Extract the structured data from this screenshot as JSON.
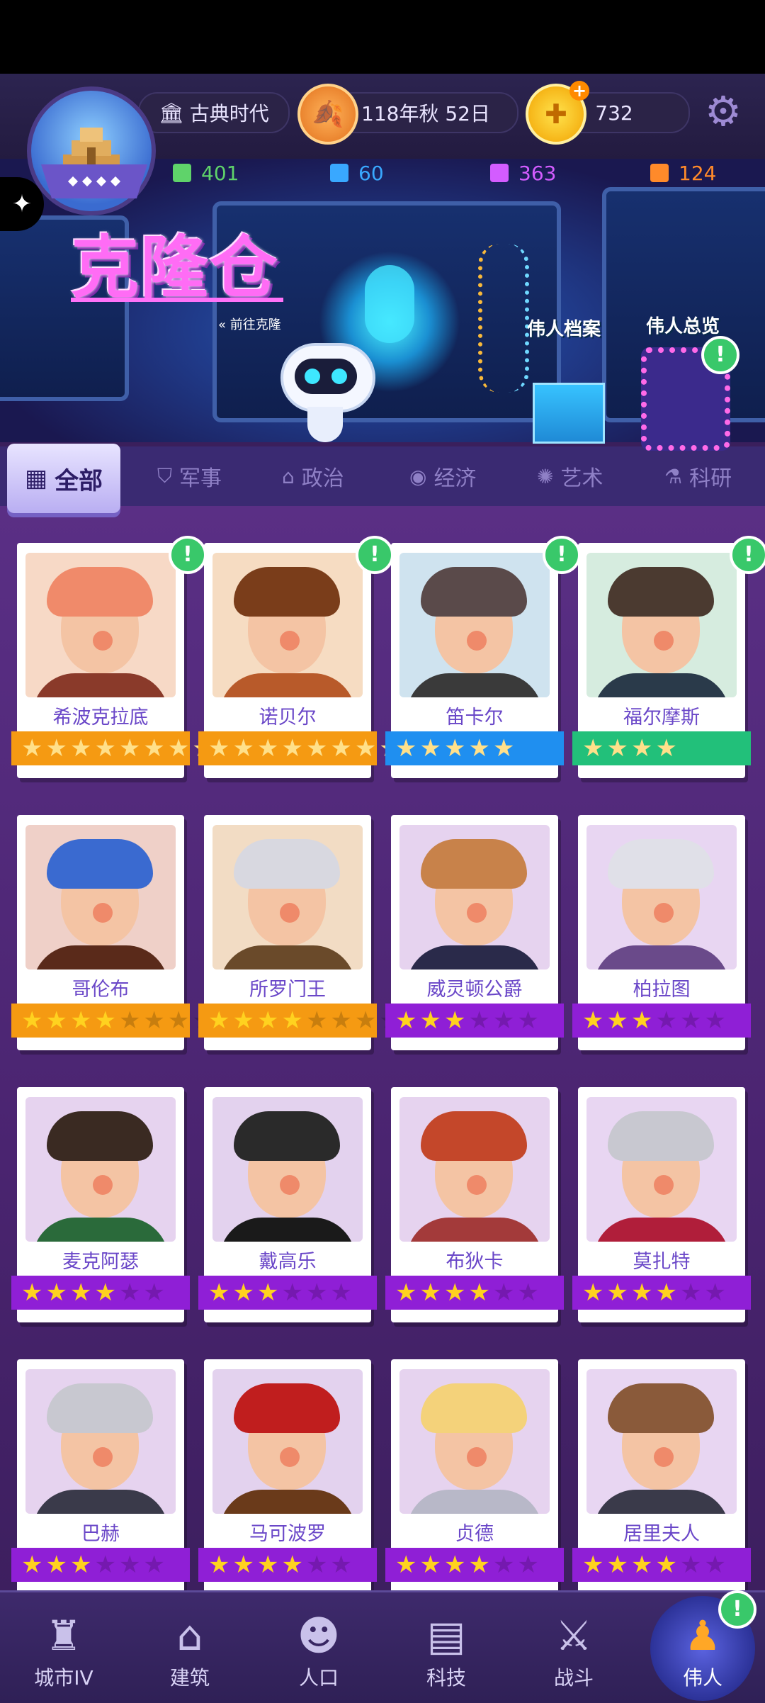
{
  "header": {
    "era": "古典时代",
    "date": "118年秋 52日",
    "coins": "732",
    "coin_plus": "+"
  },
  "resources": [
    {
      "value": "401",
      "color": "#5fd36a"
    },
    {
      "value": "60",
      "color": "#39a8ff"
    },
    {
      "value": "363",
      "color": "#d35cff"
    },
    {
      "value": "124",
      "color": "#ff8a2a"
    }
  ],
  "banner": {
    "title": "克隆仓",
    "go_clone": "前往克隆",
    "archive": "伟人档案",
    "overview": "伟人总览"
  },
  "tabs": [
    {
      "label": "全部",
      "icon": "grid-icon"
    },
    {
      "label": "军事",
      "icon": "shield-icon"
    },
    {
      "label": "政治",
      "icon": "capitol-icon"
    },
    {
      "label": "经济",
      "icon": "coins-icon"
    },
    {
      "label": "艺术",
      "icon": "palette-icon"
    },
    {
      "label": "科研",
      "icon": "flask-icon"
    }
  ],
  "greats": [
    {
      "name": "希波克拉底",
      "stars": 8,
      "max": 8,
      "tier": "orange",
      "alert": true
    },
    {
      "name": "诺贝尔",
      "stars": 8,
      "max": 8,
      "tier": "orange",
      "alert": true
    },
    {
      "name": "笛卡尔",
      "stars": 5,
      "max": 5,
      "tier": "blue",
      "alert": true
    },
    {
      "name": "福尔摩斯",
      "stars": 4,
      "max": 4,
      "tier": "green",
      "alert": true
    },
    {
      "name": "哥伦布",
      "stars": 4,
      "max": 8,
      "tier": "orange",
      "alert": false
    },
    {
      "name": "所罗门王",
      "stars": 4,
      "max": 8,
      "tier": "orange",
      "alert": false
    },
    {
      "name": "威灵顿公爵",
      "stars": 3,
      "max": 6,
      "tier": "purple",
      "alert": false
    },
    {
      "name": "柏拉图",
      "stars": 3,
      "max": 6,
      "tier": "purple",
      "alert": false
    },
    {
      "name": "麦克阿瑟",
      "stars": 4,
      "max": 6,
      "tier": "purple",
      "alert": false
    },
    {
      "name": "戴高乐",
      "stars": 3,
      "max": 6,
      "tier": "purple",
      "alert": false
    },
    {
      "name": "布狄卡",
      "stars": 4,
      "max": 6,
      "tier": "purple",
      "alert": false
    },
    {
      "name": "莫扎特",
      "stars": 4,
      "max": 6,
      "tier": "purple",
      "alert": false
    },
    {
      "name": "巴赫",
      "stars": 3,
      "max": 6,
      "tier": "purple",
      "alert": false
    },
    {
      "name": "马可波罗",
      "stars": 4,
      "max": 6,
      "tier": "purple",
      "alert": false
    },
    {
      "name": "贞德",
      "stars": 4,
      "max": 6,
      "tier": "purple",
      "alert": false
    },
    {
      "name": "居里夫人",
      "stars": 4,
      "max": 6,
      "tier": "purple",
      "alert": false
    }
  ],
  "tier_colors": {
    "orange": "#f59a12",
    "blue": "#1f8ff0",
    "green": "#22c07a",
    "purple": "#8f1fd6"
  },
  "nav": [
    {
      "label": "城市IV",
      "icon": "castle-icon"
    },
    {
      "label": "建筑",
      "icon": "house-icon"
    },
    {
      "label": "人口",
      "icon": "person-icon"
    },
    {
      "label": "科技",
      "icon": "book-icon"
    },
    {
      "label": "战斗",
      "icon": "swords-icon"
    },
    {
      "label": "伟人",
      "icon": "statue-icon"
    }
  ],
  "alert_mark": "!",
  "side_tab_icon": "puzzle-icon"
}
